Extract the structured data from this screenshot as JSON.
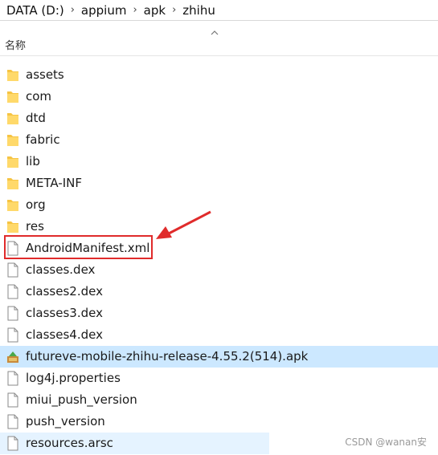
{
  "breadcrumb": [
    "DATA (D:)",
    "appium",
    "apk",
    "zhihu"
  ],
  "header": {
    "name_col": "名称"
  },
  "rows": [
    {
      "label": "assets",
      "type": "folder"
    },
    {
      "label": "com",
      "type": "folder"
    },
    {
      "label": "dtd",
      "type": "folder"
    },
    {
      "label": "fabric",
      "type": "folder"
    },
    {
      "label": "lib",
      "type": "folder"
    },
    {
      "label": "META-INF",
      "type": "folder"
    },
    {
      "label": "org",
      "type": "folder"
    },
    {
      "label": "res",
      "type": "folder"
    },
    {
      "label": "AndroidManifest.xml",
      "type": "file"
    },
    {
      "label": "classes.dex",
      "type": "file"
    },
    {
      "label": "classes2.dex",
      "type": "file"
    },
    {
      "label": "classes3.dex",
      "type": "file"
    },
    {
      "label": "classes4.dex",
      "type": "file"
    },
    {
      "label": "futureve-mobile-zhihu-release-4.55.2(514).apk",
      "type": "apk"
    },
    {
      "label": "log4j.properties",
      "type": "file"
    },
    {
      "label": "miui_push_version",
      "type": "file"
    },
    {
      "label": "push_version",
      "type": "file"
    },
    {
      "label": "resources.arsc",
      "type": "file"
    }
  ],
  "watermark": "CSDN @wanan安",
  "colors": {
    "selected": "#cce8ff",
    "hover": "#e5f3ff",
    "annotation": "#e02b2b",
    "folder": "#f6c443"
  }
}
